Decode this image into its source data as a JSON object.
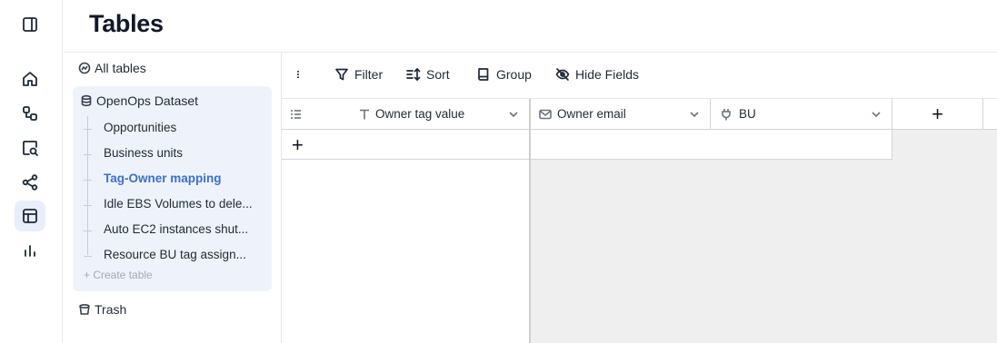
{
  "page": {
    "title": "Tables"
  },
  "sidebar": {
    "all_tables_label": "All tables",
    "dataset_label": "OpenOps Dataset",
    "tables": [
      {
        "label": "Opportunities"
      },
      {
        "label": "Business units"
      },
      {
        "label": "Tag-Owner mapping",
        "active": true
      },
      {
        "label": "Idle EBS Volumes to dele..."
      },
      {
        "label": "Auto EC2 instances shut..."
      },
      {
        "label": "Resource BU tag assign..."
      }
    ],
    "create_table_label": "+ Create table",
    "trash_label": "Trash"
  },
  "toolbar": {
    "more_icon": "more-vertical-icon",
    "filter_label": "Filter",
    "sort_label": "Sort",
    "group_label": "Group",
    "hide_fields_label": "Hide Fields"
  },
  "grid": {
    "columns": [
      {
        "name": "Owner tag value",
        "icon": "text-type-icon"
      },
      {
        "name": "Owner email",
        "icon": "email-icon"
      },
      {
        "name": "BU",
        "icon": "link-plug-icon"
      }
    ],
    "add_column_symbol": "+",
    "add_row_symbol": "+"
  },
  "colors": {
    "accent": "#3b6fc6",
    "dataset_bg": "#eef3fb",
    "grid_empty_bg": "#efefef"
  }
}
